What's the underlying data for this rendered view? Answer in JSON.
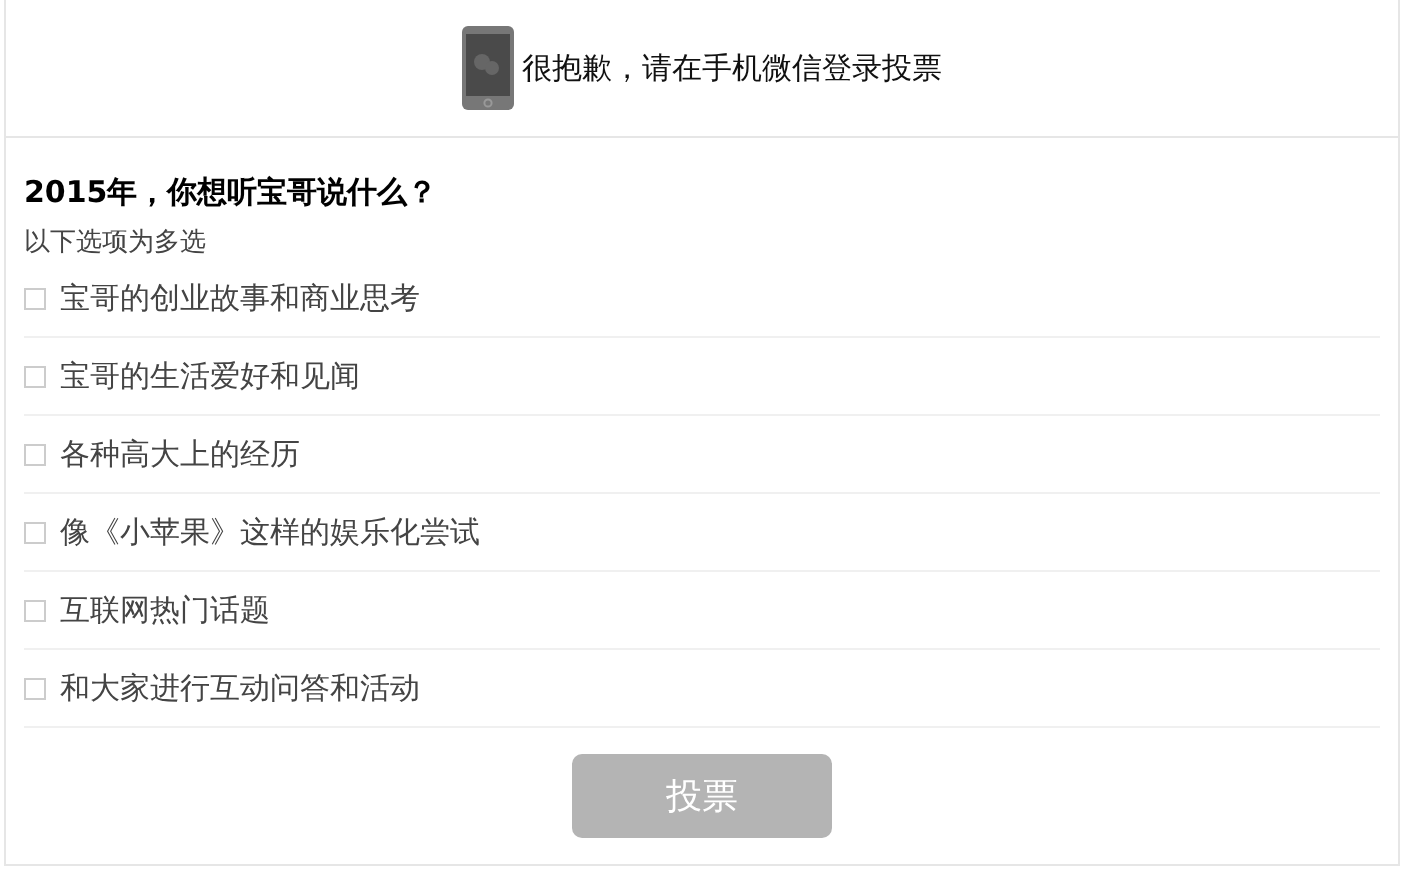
{
  "notice": {
    "text": "很抱歉，请在手机微信登录投票"
  },
  "question": {
    "title": "2015年，你想听宝哥说什么？",
    "hint": "以下选项为多选",
    "options": [
      {
        "label": "宝哥的创业故事和商业思考",
        "checked": false
      },
      {
        "label": "宝哥的生活爱好和见闻",
        "checked": false
      },
      {
        "label": "各种高大上的经历",
        "checked": false
      },
      {
        "label": "像《小苹果》这样的娱乐化尝试",
        "checked": false
      },
      {
        "label": "互联网热门话题",
        "checked": false
      },
      {
        "label": "和大家进行互动问答和活动",
        "checked": false
      }
    ]
  },
  "submit": {
    "label": "投票",
    "disabled": true
  }
}
